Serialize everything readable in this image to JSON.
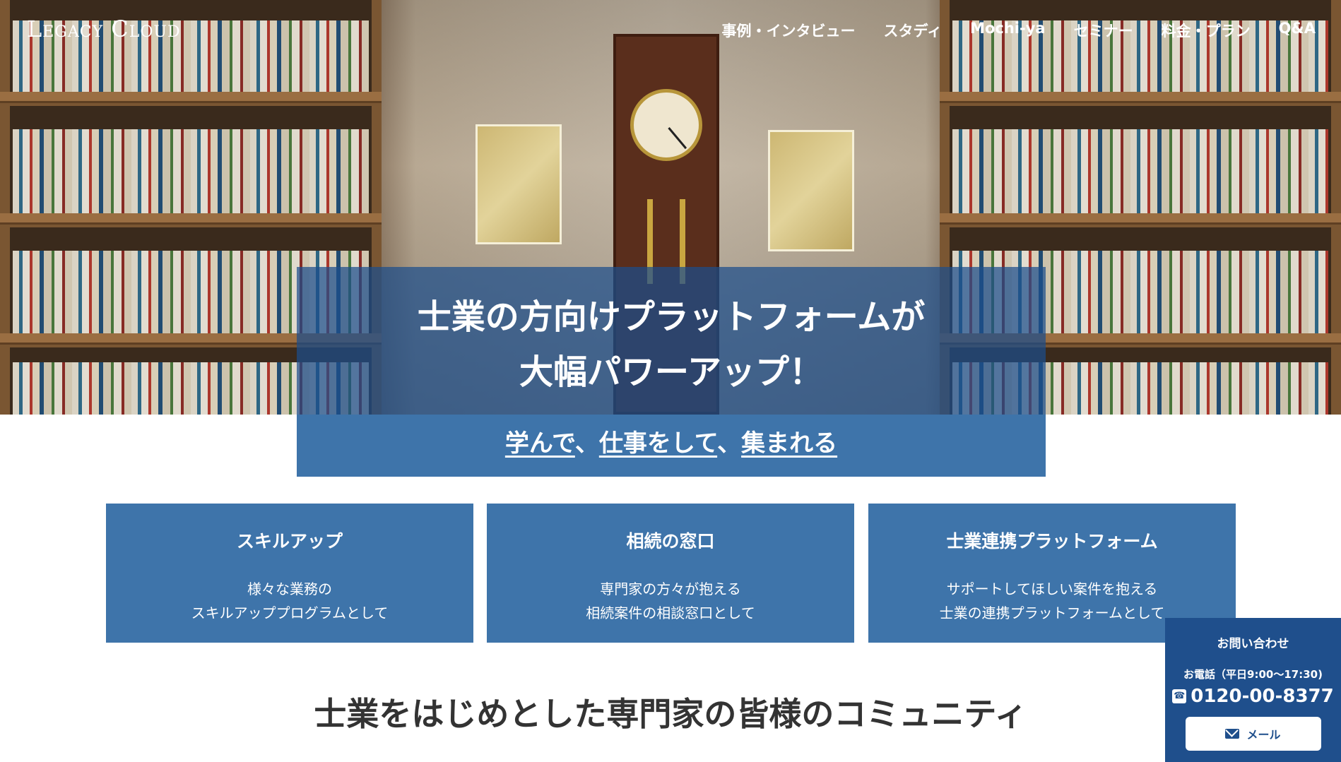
{
  "header": {
    "logo": "Legacy Cloud",
    "nav": [
      "事例・インタビュー",
      "スタディ",
      "Mochi-ya",
      "セミナー",
      "料金・プラン",
      "Q&A"
    ]
  },
  "hero": {
    "headline_line1": "士業の方向けプラットフォームが",
    "headline_line2": "大幅パワーアップ！",
    "tagline": {
      "link1": "学んで",
      "sep1": "、",
      "link2": "仕事をして",
      "sep2": "、",
      "link3": "集まれる"
    }
  },
  "cards": [
    {
      "title": "スキルアップ",
      "line1": "様々な業務の",
      "line2": "スキルアッププログラムとして"
    },
    {
      "title": "相続の窓口",
      "line1": "専門家の方々が抱える",
      "line2": "相続案件の相談窓口として"
    },
    {
      "title": "士業連携プラットフォーム",
      "line1": "サポートしてほしい案件を抱える",
      "line2": "士業の連携プラットフォームとして"
    }
  ],
  "section": {
    "title": "士業をはじめとした専門家の皆様のコミュニティ"
  },
  "contact": {
    "title": "お問い合わせ",
    "phone_label": "お電話（平日9:00〜17:30)",
    "phone": "0120-00-8377",
    "mail": "メール"
  },
  "colors": {
    "banner": "#3e74aa",
    "contact": "#1f4f8c"
  },
  "icons": {
    "phone": "phone-icon",
    "mail": "mail-icon"
  }
}
